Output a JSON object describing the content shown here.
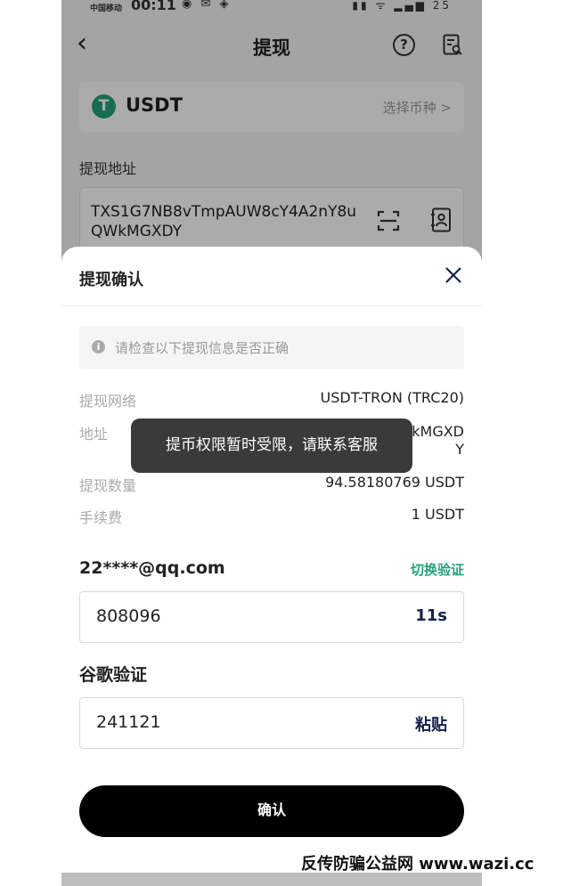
{
  "status_bar": {
    "carrier": "中国移动",
    "time": "00:11",
    "battery": "25"
  },
  "nav": {
    "title": "提现"
  },
  "coin": {
    "logo_letter": "T",
    "name": "USDT",
    "select_label": "选择币种 >"
  },
  "address_section": {
    "label": "提现地址",
    "value": "TXS1G7NB8vTmpAUW8cY4A2nY8uQWkMGXDY"
  },
  "sheet": {
    "title": "提现确认",
    "notice": "请检查以下提现信息是否正确",
    "rows": [
      {
        "label": "提现网络",
        "value": "USDT-TRON (TRC20)"
      },
      {
        "label": "地址",
        "value": "TXS1G7NB8vTmpAUW8cY4A2nY8uQWkMGXDY"
      },
      {
        "label": "提现数量",
        "value": "94.58180769 USDT"
      },
      {
        "label": "手续费",
        "value": "1 USDT"
      }
    ],
    "address_visible_tail": "kMGXD\nY",
    "toast": "提币权限暂时受限，请联系客服",
    "email": "22****@qq.com",
    "switch_verify": "切换验证",
    "email_code": {
      "value": "808096",
      "countdown": "11s"
    },
    "google_label": "谷歌验证",
    "google_code": {
      "value": "241121",
      "paste_label": "粘贴"
    },
    "confirm_label": "确认"
  },
  "watermark": "反传防骗公益网 www.wazi.cc",
  "colors": {
    "accent_green": "#26a17b",
    "button_black": "#000000",
    "toast_bg": "#3a3a3a"
  }
}
